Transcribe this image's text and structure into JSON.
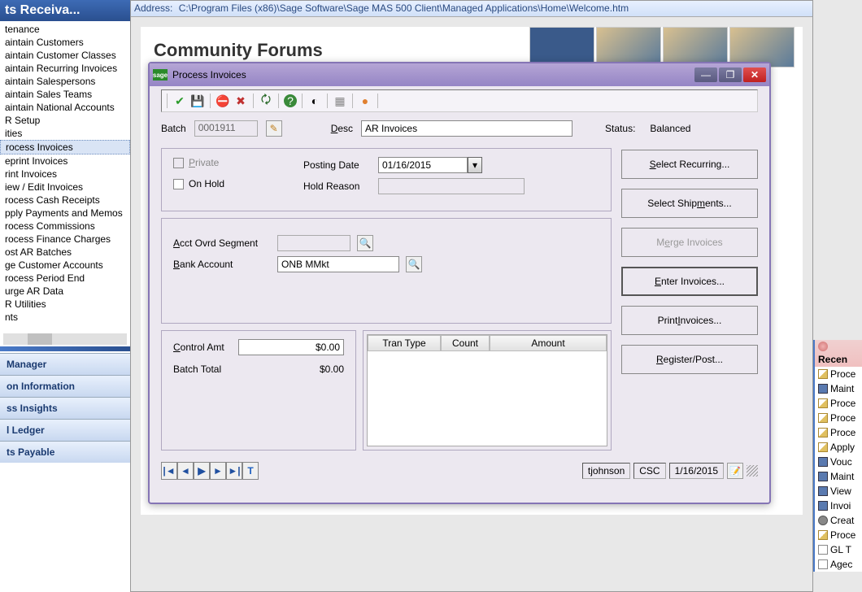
{
  "left": {
    "header": "ts  Receiva...",
    "items": [
      "tenance",
      "aintain Customers",
      "aintain Customer Classes",
      "aintain Recurring Invoices",
      "aintain Salespersons",
      "aintain Sales Teams",
      "aintain National Accounts",
      "R Setup",
      "ities",
      "rocess Invoices",
      "eprint Invoices",
      "rint Invoices",
      "iew / Edit Invoices",
      "rocess Cash Receipts",
      "pply Payments and Memos",
      "rocess Commissions",
      "rocess Finance Charges",
      "ost AR Batches",
      "ge Customer Accounts",
      "rocess Period End",
      "urge AR Data",
      "R Utilities",
      "nts"
    ],
    "selected_index": 9,
    "sections": [
      "Manager",
      "on Information",
      "ss Insights",
      "l Ledger",
      "ts Payable"
    ]
  },
  "address": {
    "label": "Address:",
    "value": "C:\\Program Files (x86)\\Sage Software\\Sage MAS 500 Client\\Managed Applications\\Home\\Welcome.htm"
  },
  "welcome": {
    "title": "Community Forums"
  },
  "dialog": {
    "icon_text": "sage",
    "title": "Process Invoices",
    "batch_label": "Batch",
    "batch_value": "0001911",
    "desc_label": "Desc",
    "desc_value": "AR Invoices",
    "status_label": "Status:",
    "status_value": "Balanced",
    "private_label": "Private",
    "onhold_label": "On Hold",
    "posting_date_label": "Posting Date",
    "posting_date_value": "01/16/2015",
    "hold_reason_label": "Hold Reason",
    "hold_reason_value": "",
    "acct_label": "Acct Ovrd Segment",
    "acct_value": "",
    "bank_label": "Bank Account",
    "bank_value": "ONB MMkt",
    "control_amt_label": "Control Amt",
    "control_amt_value": "$0.00",
    "batch_total_label": "Batch Total",
    "batch_total_value": "$0.00",
    "table": {
      "h1": "Tran Type",
      "h2": "Count",
      "h3": "Amount"
    },
    "buttons": {
      "select_recurring": "Select Recurring...",
      "select_shipments": "Select Shipments...",
      "merge_invoices": "Merge Invoices",
      "enter_invoices": "Enter Invoices...",
      "print_invoices": "Print Invoices...",
      "register_post": "Register/Post..."
    },
    "status_bar": {
      "user": "tjohnson",
      "company": "CSC",
      "date": "1/16/2015"
    }
  },
  "right": {
    "header": "Recen",
    "items": [
      "Proce",
      "Maint",
      "Proce",
      "Proce",
      "Proce",
      "Apply",
      "Vouc",
      "Maint",
      "View",
      "Invoi",
      "Creat",
      "Proce",
      "GL T",
      "Agec"
    ]
  },
  "icons": {
    "check": "✔",
    "save": "💾",
    "no": "⛔",
    "x": "✖",
    "refresh": "🗘",
    "help": "?",
    "pie": "◐",
    "grid": "▦",
    "orange": "●",
    "pencil": "✎",
    "search": "🔍",
    "first": "|◄",
    "prev": "◄",
    "stop": "▶|",
    "next": "►",
    "last": "►|",
    "filter": "▼",
    "edit": "📝",
    "min": "—",
    "max": "❐",
    "close": "✕"
  }
}
